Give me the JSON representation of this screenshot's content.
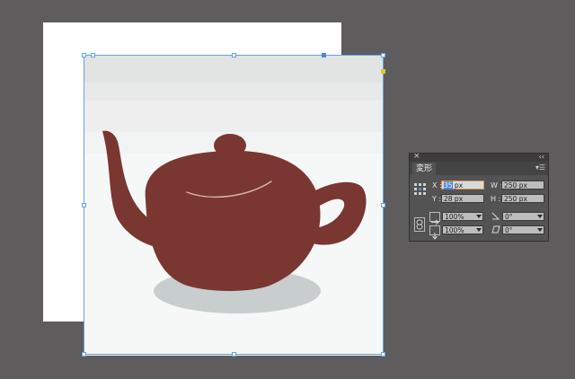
{
  "transform_panel": {
    "tab_label": "変形",
    "close_glyph": "×",
    "collapse_glyph": "‹‹",
    "menu_glyph": "▾☰",
    "x_label": "X :",
    "x_value_highlight": "35",
    "x_value_unit": " px",
    "y_label": "Y :",
    "y_value": "28 px",
    "w_label": "W :",
    "w_value": "250 px",
    "h_label": "H :",
    "h_value": "250 px",
    "scale_x_value": "100%",
    "scale_y_value": "100%",
    "rotate_value": "0°",
    "shear_value": "0°"
  },
  "colors": {
    "workspace": "#5f5c5d",
    "teapot": "#7a3630",
    "shadow": "#c8cdcd",
    "selection": "#6aa1e0"
  },
  "icons": {
    "link_icon": "chain-link-icon",
    "rotate_icon": "rotate-angle-icon",
    "shear_icon": "shear-angle-icon",
    "reference_point": "reference-point-grid-icon"
  }
}
